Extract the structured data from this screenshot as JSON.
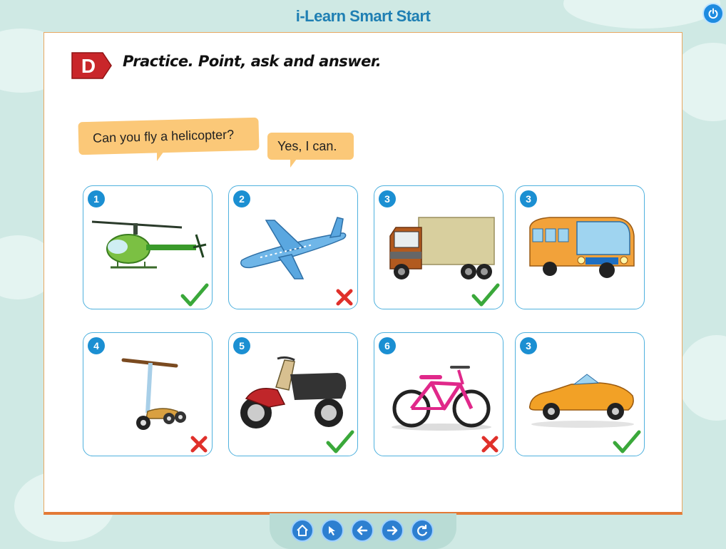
{
  "app": {
    "title": "i-Learn Smart Start"
  },
  "section": {
    "letter": "D",
    "instruction": "Practice. Point, ask and answer."
  },
  "dialogue": {
    "question": "Can you fly a helicopter?",
    "answer": "Yes, I can."
  },
  "cards": [
    {
      "number": "1",
      "vehicle": "helicopter",
      "mark": "check"
    },
    {
      "number": "2",
      "vehicle": "airplane",
      "mark": "cross"
    },
    {
      "number": "3",
      "vehicle": "truck",
      "mark": "check"
    },
    {
      "number": "3",
      "vehicle": "bus",
      "mark": "none"
    },
    {
      "number": "4",
      "vehicle": "scooter",
      "mark": "cross"
    },
    {
      "number": "5",
      "vehicle": "motorbike",
      "mark": "check"
    },
    {
      "number": "6",
      "vehicle": "bicycle",
      "mark": "cross"
    },
    {
      "number": "3",
      "vehicle": "car",
      "mark": "check"
    }
  ],
  "nav": {
    "buttons": [
      "home-icon",
      "pointer-icon",
      "arrow-left-icon",
      "arrow-right-icon",
      "refresh-icon"
    ]
  },
  "colors": {
    "accent": "#1b8fd2",
    "check": "#3aa83a",
    "cross": "#e0302a",
    "bubble": "#fbc878",
    "border": "#e37a36"
  }
}
